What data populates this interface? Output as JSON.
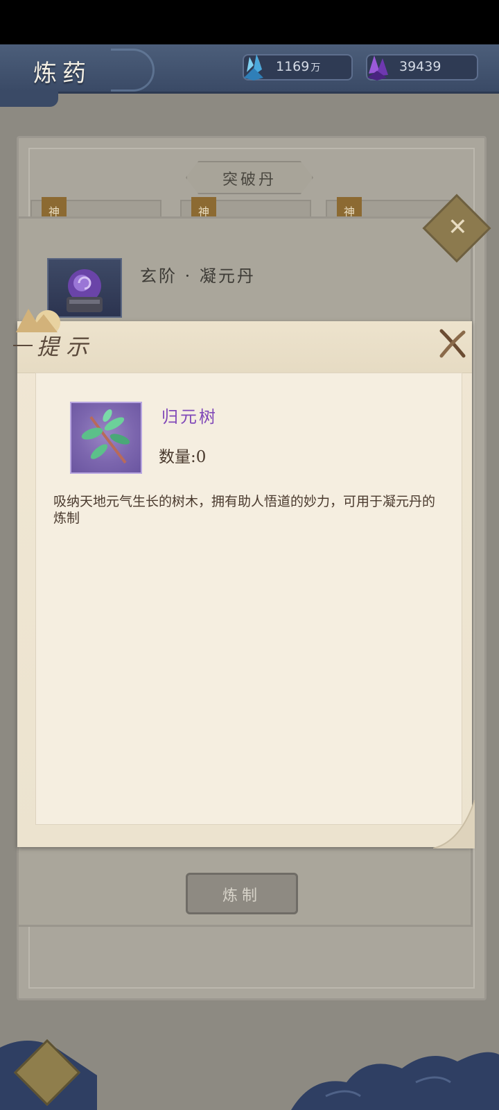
{
  "header": {
    "title": "炼药",
    "currency_crystal": {
      "value": "1169",
      "unit": "万",
      "icon": "blue-crystal-icon",
      "color": "#5fb8e6"
    },
    "currency_gem": {
      "value": "39439",
      "icon": "purple-gem-icon",
      "color": "#8a4fc8"
    }
  },
  "background": {
    "tab_label": "突破丹",
    "slot_marks": [
      "神",
      "神",
      "神"
    ],
    "elixir_title": "玄阶 · 凝元丹",
    "refine_button": "炼制"
  },
  "modal": {
    "title": "提示",
    "item": {
      "name": "归元树",
      "quantity_label": "数量:",
      "quantity_value": "0",
      "description": "吸纳天地元气生长的树木，拥有助人悟道的妙力，可用于凝元丹的炼制",
      "icon": "branch-icon",
      "name_color": "#8048b8"
    }
  }
}
